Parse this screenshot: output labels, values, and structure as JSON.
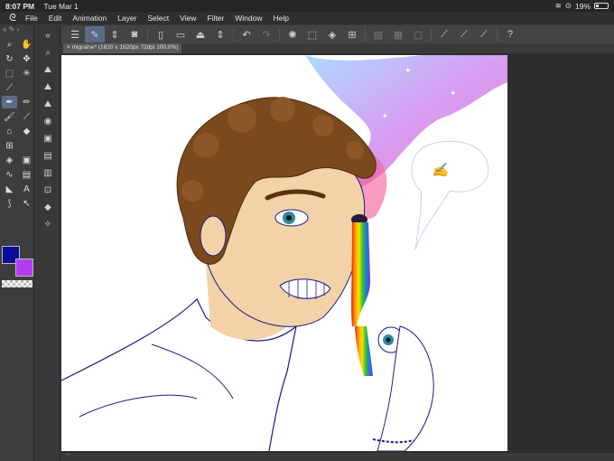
{
  "status": {
    "time": "8:07 PM",
    "date": "Tue Mar 1",
    "battery": "19%",
    "battery_level": 0.19
  },
  "menu": {
    "logo_icon": "clip-studio-logo-icon",
    "items": [
      "File",
      "Edit",
      "Animation",
      "Layer",
      "Select",
      "View",
      "Filter",
      "Window",
      "Help"
    ]
  },
  "document": {
    "tab_label": "migraine* (1620 x 1620px 72dpi 100.0%)"
  },
  "colors": {
    "main": "#0c0c9a",
    "sub": "#b43cf5",
    "toolbar_accent": "#5b6b86"
  }
}
